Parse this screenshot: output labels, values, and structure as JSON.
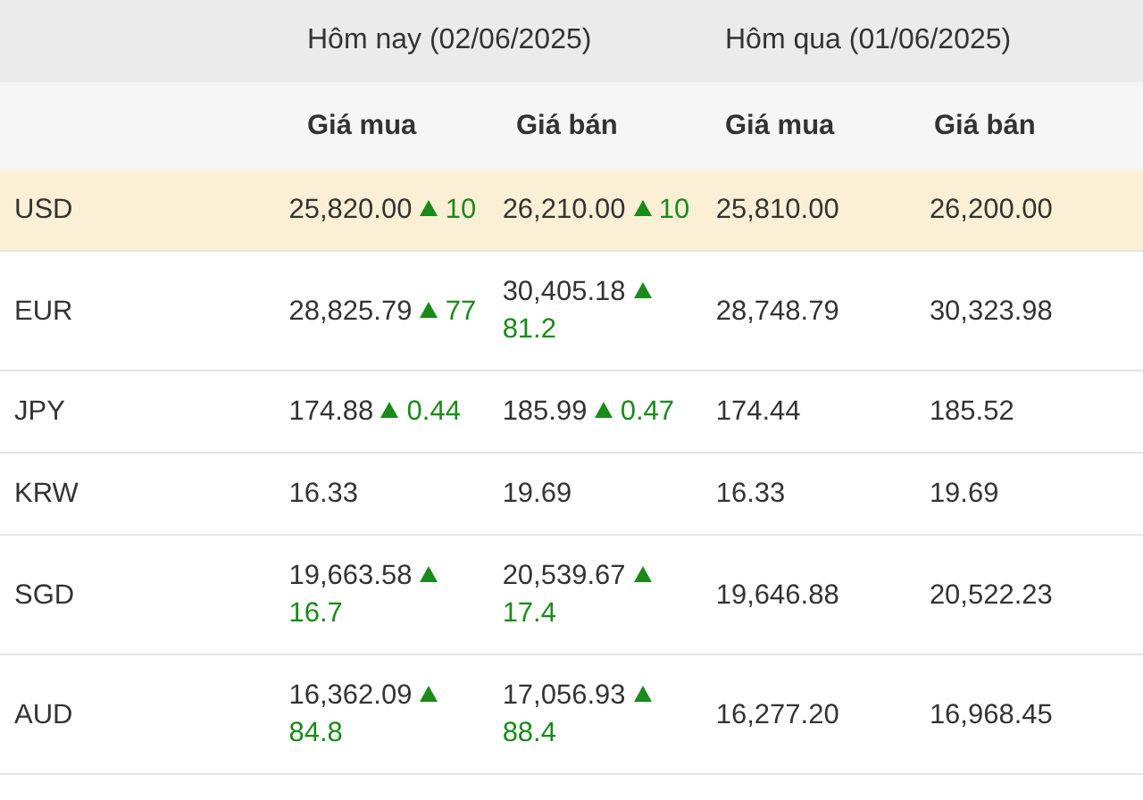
{
  "periods": [
    {
      "label": "Hôm nay (02/06/2025)"
    },
    {
      "label": "Hôm qua (01/06/2025)"
    }
  ],
  "columns": [
    "Giá mua",
    "Giá bán",
    "Giá mua",
    "Giá bán"
  ],
  "rows": [
    {
      "currency": "USD",
      "selected": true,
      "cells": [
        {
          "value": "25,820.00",
          "rising": true,
          "change": "10"
        },
        {
          "value": "26,210.00",
          "rising": true,
          "change": "10"
        },
        {
          "value": "25,810.00"
        },
        {
          "value": "26,200.00"
        }
      ]
    },
    {
      "currency": "EUR",
      "selected": false,
      "cells": [
        {
          "value": "28,825.79",
          "rising": true,
          "change": "77"
        },
        {
          "value": "30,405.18",
          "rising": true,
          "change": "81.2"
        },
        {
          "value": "28,748.79"
        },
        {
          "value": "30,323.98"
        }
      ]
    },
    {
      "currency": "JPY",
      "selected": false,
      "cells": [
        {
          "value": "174.88",
          "rising": true,
          "change": "0.44"
        },
        {
          "value": "185.99",
          "rising": true,
          "change": "0.47"
        },
        {
          "value": "174.44"
        },
        {
          "value": "185.52"
        }
      ]
    },
    {
      "currency": "KRW",
      "selected": false,
      "cells": [
        {
          "value": "16.33"
        },
        {
          "value": "19.69"
        },
        {
          "value": "16.33"
        },
        {
          "value": "19.69"
        }
      ]
    },
    {
      "currency": "SGD",
      "selected": false,
      "cells": [
        {
          "value": "19,663.58",
          "rising": true,
          "change": "16.7"
        },
        {
          "value": "20,539.67",
          "rising": true,
          "change": "17.4"
        },
        {
          "value": "19,646.88"
        },
        {
          "value": "20,522.23"
        }
      ]
    },
    {
      "currency": "AUD",
      "selected": false,
      "cells": [
        {
          "value": "16,362.09",
          "rising": true,
          "change": "84.8"
        },
        {
          "value": "17,056.93",
          "rising": true,
          "change": "88.4"
        },
        {
          "value": "16,277.20"
        },
        {
          "value": "16,968.45"
        }
      ]
    }
  ]
}
